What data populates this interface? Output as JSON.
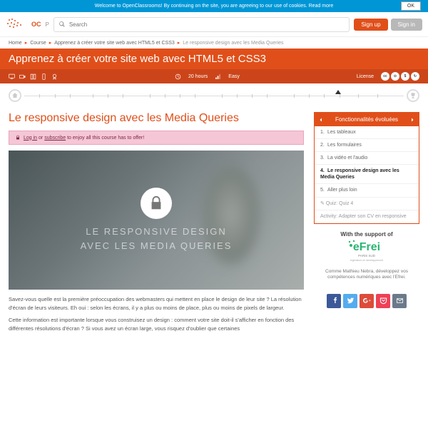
{
  "cookie": {
    "message": "Welcome to OpenClassrooms! By continuing on the site, you are agreeing to our use of cookies. Read more",
    "ok": "OK"
  },
  "brand": {
    "initials": "OC",
    "p": "P"
  },
  "search": {
    "placeholder": "Search"
  },
  "auth": {
    "signup": "Sign up",
    "signin": "Sign in"
  },
  "breadcrumb": {
    "home": "Home",
    "course": "Course",
    "course_name": "Apprenez à créer votre site web avec HTML5 et CSS3",
    "current": "Le responsive design avec les Media Queries"
  },
  "course": {
    "title": "Apprenez à créer votre site web avec HTML5 et CSS3",
    "duration": "20 hours",
    "level": "Easy",
    "license_label": "License"
  },
  "lesson": {
    "title": "Le responsive design avec les Media Queries",
    "login_prefix": "Log in",
    "login_mid": " or ",
    "login_sub": "subscribe",
    "login_suffix": " to enjoy all this course has to offer!",
    "video_line1": "LE RESPONSIVE DESIGN",
    "video_line2": "AVEC LES MEDIA QUERIES",
    "para1": "Savez-vous quelle est la première préoccupation des webmasters qui mettent en place le design de leur site ? La résolution d'écran de leurs visiteurs. Eh oui : selon les écrans, il y a plus ou moins de place, plus ou moins de pixels de largeur.",
    "para2": "Cette information est importante lorsque vous construisez un design : comment votre site doit-il s'afficher en fonction des différentes résolutions d'écran ? Si vous avez un écran large, vous risquez d'oublier que certaines"
  },
  "nav": {
    "section": "Fonctionnalités évoluées",
    "items": [
      {
        "num": "1.",
        "label": "Les tableaux"
      },
      {
        "num": "2.",
        "label": "Les formulaires"
      },
      {
        "num": "3.",
        "label": "La vidéo et l'audio"
      },
      {
        "num": "4.",
        "label": "Le responsive design avec les Media Queries"
      },
      {
        "num": "5.",
        "label": "Aller plus loin"
      }
    ],
    "quiz": "Quiz: Quiz 4",
    "activity": "Activity: Adapter son CV en responsive"
  },
  "support": {
    "heading": "With the support of",
    "sponsor": "eFrei",
    "sponsor_sub1": "PARIS SUD",
    "sponsor_sub2": "Ingénieurs en développement",
    "tagline": "Comme Mathieu Nebra, développez vos compétences numériques avec l'Efrei."
  }
}
